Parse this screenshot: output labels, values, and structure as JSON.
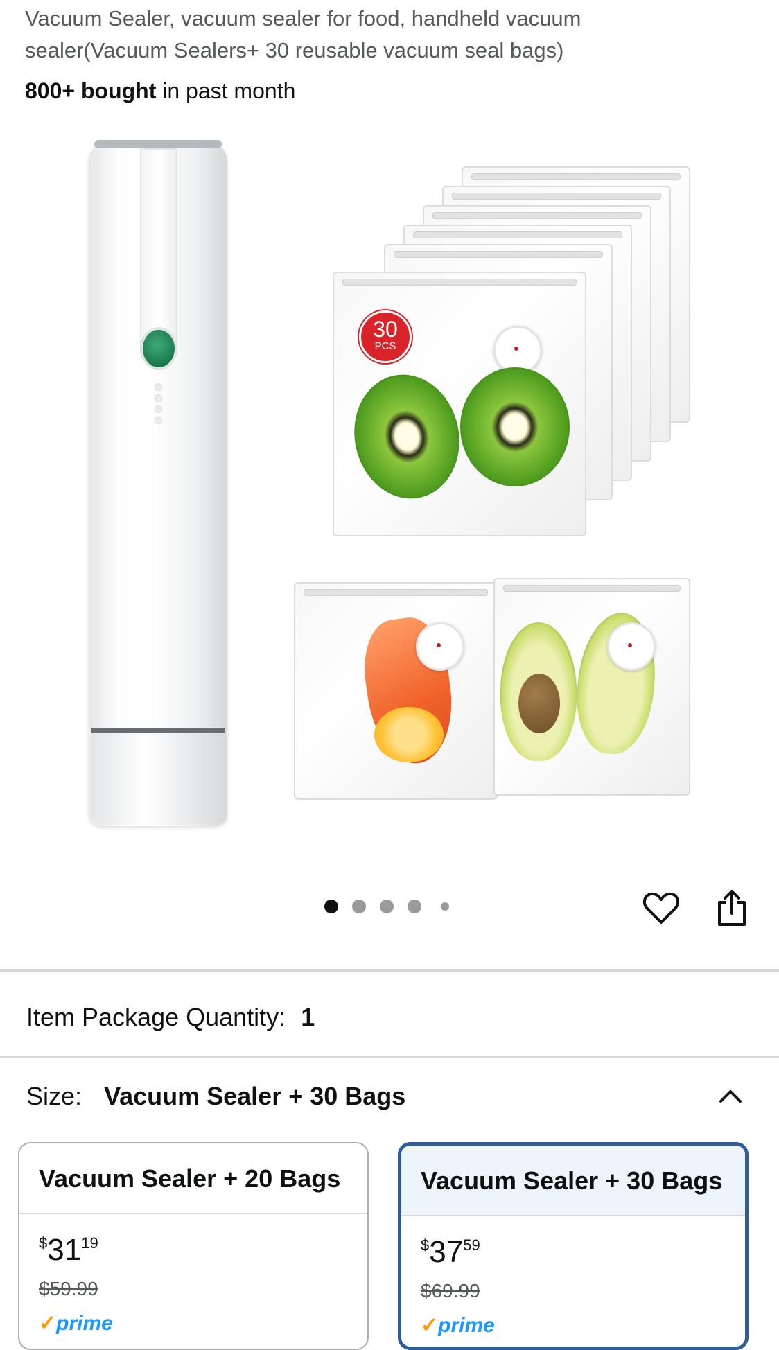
{
  "product": {
    "title": "Vacuum Sealer, vacuum sealer for food, handheld vacuum sealer(Vacuum Sealers+ 30 reusable vacuum seal bags)",
    "bought_count": "800+ bought",
    "bought_suffix": " in past month"
  },
  "gallery": {
    "badge_number": "30",
    "badge_unit": "PCS",
    "dots_total": 5,
    "active_dot": 1,
    "favorite_icon": "heart-outline-icon",
    "share_icon": "share-icon"
  },
  "package_quantity": {
    "label": "Item Package Quantity:",
    "value": "1"
  },
  "size": {
    "label": "Size:",
    "selected_value": "Vacuum Sealer + 30 Bags",
    "collapse_icon": "chevron-up-icon",
    "options": [
      {
        "name": "Vacuum Sealer + 20 Bags",
        "currency": "$",
        "price_whole": "31",
        "price_fraction": "19",
        "list_price": "$59.99",
        "prime": "prime",
        "selected": false
      },
      {
        "name": "Vacuum Sealer + 30 Bags",
        "currency": "$",
        "price_whole": "37",
        "price_fraction": "59",
        "list_price": "$69.99",
        "prime": "prime",
        "selected": true
      }
    ]
  },
  "colors": {
    "selected_border": "#2e5d98",
    "selected_bg": "#edf5fb",
    "prime_blue": "#1a98ff",
    "badge_red": "#d8232a"
  }
}
